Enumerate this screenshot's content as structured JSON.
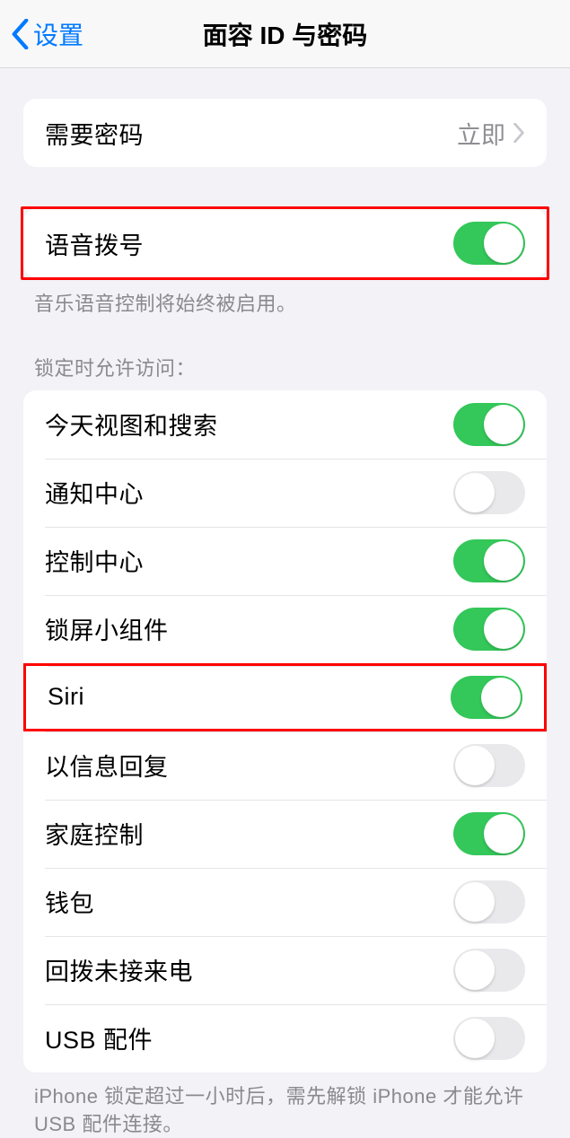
{
  "header": {
    "back_label": "设置",
    "title": "面容 ID 与密码"
  },
  "require_passcode": {
    "label": "需要密码",
    "value": "立即"
  },
  "voice_dial": {
    "label": "语音拨号",
    "on": true,
    "footer": "音乐语音控制将始终被启用。"
  },
  "lock_section": {
    "header": "锁定时允许访问：",
    "items": [
      {
        "label": "今天视图和搜索",
        "on": true
      },
      {
        "label": "通知中心",
        "on": false
      },
      {
        "label": "控制中心",
        "on": true
      },
      {
        "label": "锁屏小组件",
        "on": true
      },
      {
        "label": "Siri",
        "on": true
      },
      {
        "label": "以信息回复",
        "on": false
      },
      {
        "label": "家庭控制",
        "on": true
      },
      {
        "label": "钱包",
        "on": false
      },
      {
        "label": "回拨未接来电",
        "on": false
      },
      {
        "label": "USB 配件",
        "on": false
      }
    ],
    "footer": "iPhone 锁定超过一小时后，需先解锁 iPhone 才能允许 USB 配件连接。"
  }
}
